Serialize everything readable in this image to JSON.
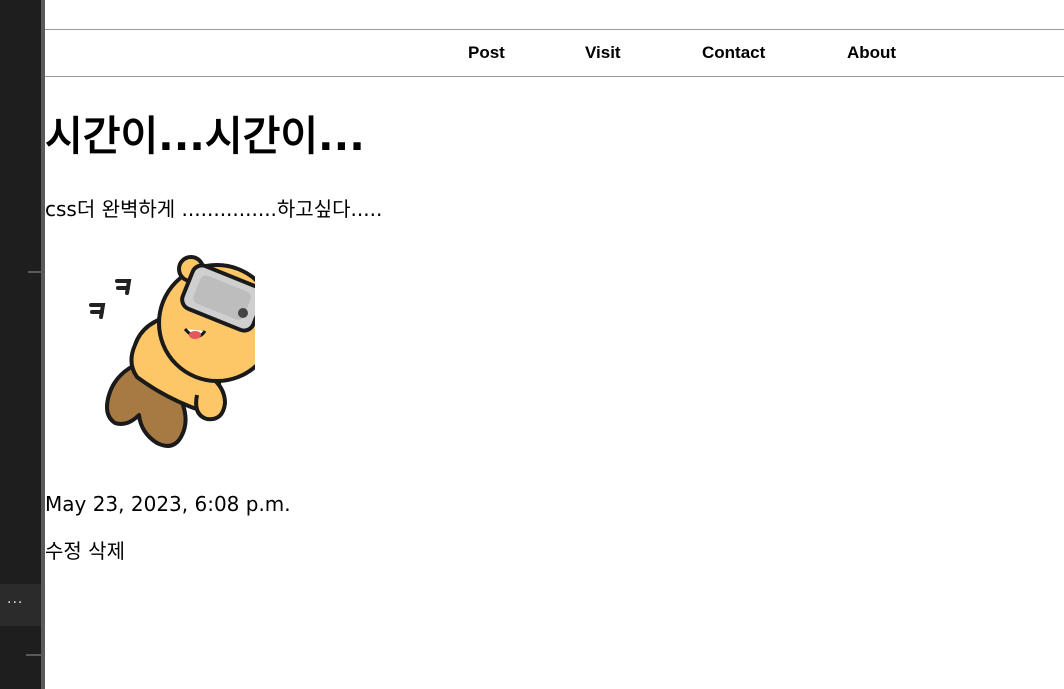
{
  "nav": {
    "items": [
      {
        "label": "Post"
      },
      {
        "label": "Visit"
      },
      {
        "label": "Contact"
      },
      {
        "label": "About"
      }
    ]
  },
  "post": {
    "title": "시간이...시간이...",
    "body": "css더 완벽하게 ...............하고싶다.....",
    "image_icon": "character-lying-with-phone-illustration",
    "date": "May 23, 2023, 6:08 p.m.",
    "edit_label": "수정",
    "delete_label": "삭제"
  },
  "editor": {
    "menu_glyph": "···"
  }
}
